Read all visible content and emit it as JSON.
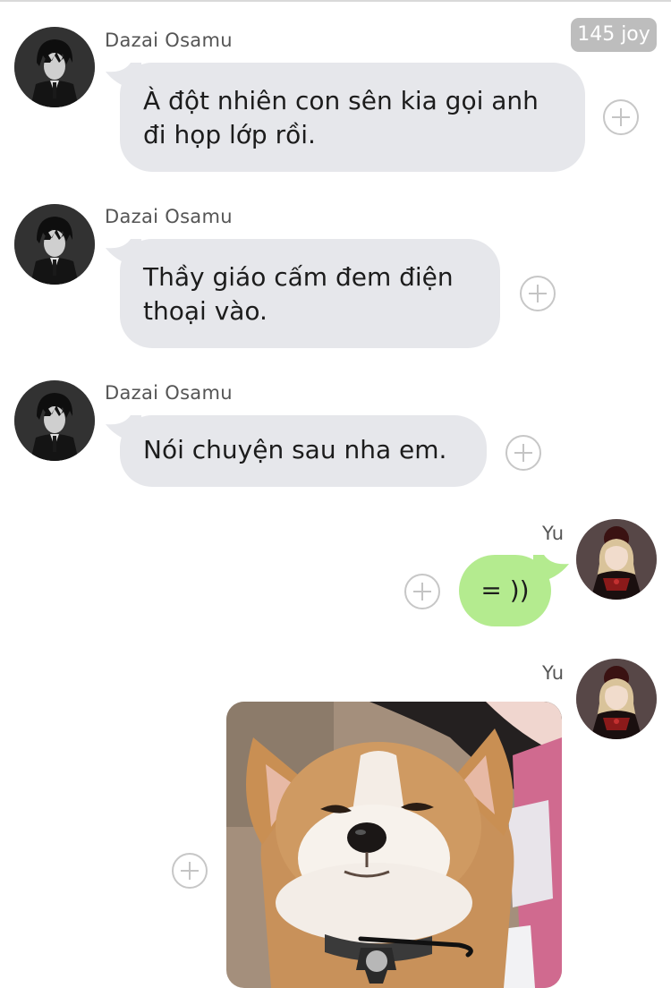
{
  "badge": {
    "text": "145 joy"
  },
  "messages": [
    {
      "sender": "Dazai Osamu",
      "text": "À đột nhiên con sên kia gọi anh đi họp lớp rồi."
    },
    {
      "sender": "Dazai Osamu",
      "text": "Thầy giáo cấm đem điện thoại vào."
    },
    {
      "sender": "Dazai Osamu",
      "text": "Nói chuyện sau nha em."
    },
    {
      "sender": "Yu",
      "text": "= ))"
    },
    {
      "sender": "Yu",
      "attachment": "dog-photo"
    }
  ],
  "colors": {
    "incoming_bubble": "#e6e7eb",
    "outgoing_bubble": "#b4eb8f",
    "badge": "#bdbdbd"
  },
  "icons": [
    "add-reaction-icon",
    "avatar-dazai",
    "avatar-yu"
  ]
}
